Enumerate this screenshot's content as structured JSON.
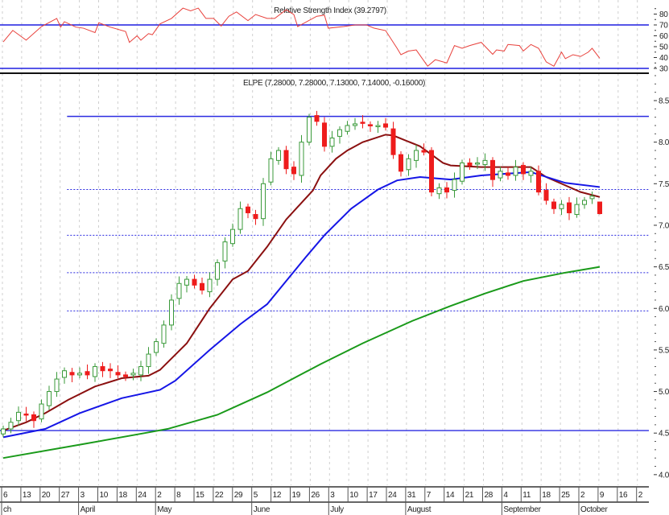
{
  "chart_data": [
    {
      "type": "line",
      "panel": "rsi",
      "title": "Relative Strength Index (39.2797)",
      "ylim": [
        30,
        85
      ],
      "yticks": [
        80,
        70,
        60,
        50,
        40,
        30
      ],
      "reference_lines": [
        70,
        30
      ],
      "colors": {
        "line": "#e8413c",
        "reference": "#1f1fe0"
      },
      "series": [
        {
          "name": "RSI",
          "points": [
            [
              0,
              54.4
            ],
            [
              2.5,
              65
            ],
            [
              6,
              56
            ],
            [
              10,
              68.5
            ],
            [
              14,
              76
            ],
            [
              15,
              68
            ],
            [
              16,
              73
            ],
            [
              19,
              68
            ],
            [
              21,
              67
            ],
            [
              24,
              63
            ],
            [
              25,
              72
            ],
            [
              28,
              68
            ],
            [
              32,
              64
            ],
            [
              33,
              54
            ],
            [
              35,
              60
            ],
            [
              36,
              56
            ],
            [
              38,
              62
            ],
            [
              39,
              61
            ],
            [
              41,
              71
            ],
            [
              44,
              76
            ],
            [
              47,
              85.5
            ],
            [
              49,
              83
            ],
            [
              51,
              85.5
            ],
            [
              53,
              76
            ],
            [
              55,
              76
            ],
            [
              57,
              69
            ],
            [
              59,
              78
            ],
            [
              61,
              82
            ],
            [
              64,
              74
            ],
            [
              66,
              79.6
            ],
            [
              69,
              76
            ],
            [
              71,
              76
            ],
            [
              74,
              84
            ],
            [
              76,
              79.6
            ],
            [
              77,
              68.5
            ],
            [
              82,
              78
            ],
            [
              84,
              79
            ],
            [
              85,
              67
            ],
            [
              89,
              68.5
            ],
            [
              92,
              70
            ],
            [
              95,
              70
            ],
            [
              97,
              67
            ],
            [
              100,
              64.8
            ],
            [
              103,
              48.5
            ],
            [
              104,
              42.6
            ],
            [
              106,
              46
            ],
            [
              108,
              47
            ],
            [
              111,
              32
            ],
            [
              113,
              38
            ],
            [
              116,
              35
            ],
            [
              118,
              51
            ],
            [
              120,
              48.5
            ],
            [
              122,
              51
            ],
            [
              125,
              54
            ],
            [
              128,
              43
            ],
            [
              129,
              47
            ],
            [
              131,
              46
            ],
            [
              132,
              52
            ],
            [
              135,
              51
            ],
            [
              136,
              46
            ],
            [
              138,
              52
            ],
            [
              140,
              48.5
            ],
            [
              142,
              36
            ],
            [
              144,
              32
            ],
            [
              146,
              45
            ],
            [
              147,
              39
            ],
            [
              149,
              42.6
            ],
            [
              151,
              41
            ],
            [
              153,
              45
            ],
            [
              154,
              48.5
            ],
            [
              156,
              39.3
            ]
          ]
        }
      ]
    },
    {
      "type": "candlestick",
      "panel": "price",
      "title": "ELPE (7.28000, 7.28000, 7.13000, 7.14000, -0.16000)",
      "ylim": [
        3.9,
        8.65
      ],
      "yticks": [
        "8.5",
        "8.0",
        "7.5",
        "7.0",
        "6.5",
        "6.0",
        "5.5",
        "5.0",
        "4.5",
        "4.0"
      ],
      "last_bar": {
        "open": 7.28,
        "high": 7.28,
        "low": 7.13,
        "close": 7.14,
        "change": -0.16
      },
      "colors": {
        "up": "#3a9a3a",
        "down": "#ee1c1c",
        "ma_short": "#8b1010",
        "ma_mid": "#1515e6",
        "ma_long": "#1a9a1a",
        "levels": "#2a2ae0"
      },
      "candle_day_step": 2,
      "closes": [
        4.55,
        4.63,
        4.75,
        4.72,
        4.65,
        4.85,
        5.0,
        5.15,
        5.25,
        5.2,
        5.22,
        5.2,
        5.3,
        5.25,
        5.25,
        5.2,
        5.18,
        5.22,
        5.3,
        5.45,
        5.6,
        5.8,
        6.1,
        6.3,
        6.35,
        6.28,
        6.22,
        6.35,
        6.55,
        6.8,
        6.95,
        7.2,
        7.15,
        7.08,
        7.5,
        7.8,
        7.9,
        7.68,
        7.62,
        8.0,
        8.3,
        8.25,
        7.95,
        8.05,
        8.15,
        8.2,
        8.22,
        8.23,
        8.2,
        8.2,
        8.18,
        7.85,
        7.65,
        7.8,
        7.9,
        7.88,
        7.4,
        7.45,
        7.4,
        7.55,
        7.75,
        7.72,
        7.75,
        7.78,
        7.55,
        7.65,
        7.6,
        7.7,
        7.62,
        7.65,
        7.4,
        7.3,
        7.2,
        7.25,
        7.15,
        7.25,
        7.3,
        7.35,
        7.14
      ],
      "moving_averages": [
        {
          "name": "MA short",
          "color_key": "ma_short",
          "points": [
            [
              0,
              4.53
            ],
            [
              6,
              4.63
            ],
            [
              11,
              4.74
            ],
            [
              17,
              4.9
            ],
            [
              24,
              5.06
            ],
            [
              31,
              5.16
            ],
            [
              38,
              5.19
            ],
            [
              41,
              5.26
            ],
            [
              48,
              5.58
            ],
            [
              54,
              6.0
            ],
            [
              60,
              6.35
            ],
            [
              64,
              6.45
            ],
            [
              69,
              6.74
            ],
            [
              74,
              7.07
            ],
            [
              77,
              7.22
            ],
            [
              81,
              7.42
            ],
            [
              83,
              7.6
            ],
            [
              87,
              7.8
            ],
            [
              90,
              7.9
            ],
            [
              94,
              8.0
            ],
            [
              100,
              8.09
            ],
            [
              102,
              8.08
            ],
            [
              109,
              7.95
            ],
            [
              115,
              7.75
            ],
            [
              117,
              7.72
            ],
            [
              125,
              7.7
            ],
            [
              138,
              7.7
            ],
            [
              142,
              7.58
            ],
            [
              147,
              7.48
            ],
            [
              151,
              7.4
            ],
            [
              156,
              7.34
            ]
          ]
        },
        {
          "name": "MA mid",
          "color_key": "ma_mid",
          "points": [
            [
              0,
              4.45
            ],
            [
              11,
              4.55
            ],
            [
              20,
              4.74
            ],
            [
              31,
              4.92
            ],
            [
              41,
              5.02
            ],
            [
              45,
              5.13
            ],
            [
              54,
              5.5
            ],
            [
              62,
              5.81
            ],
            [
              69,
              6.05
            ],
            [
              79,
              6.61
            ],
            [
              84,
              6.88
            ],
            [
              91,
              7.2
            ],
            [
              98,
              7.43
            ],
            [
              103,
              7.54
            ],
            [
              109,
              7.58
            ],
            [
              117,
              7.55
            ],
            [
              125,
              7.6
            ],
            [
              138,
              7.64
            ],
            [
              147,
              7.51
            ],
            [
              156,
              7.46
            ]
          ]
        },
        {
          "name": "MA long",
          "color_key": "ma_long",
          "points": [
            [
              0,
              4.2
            ],
            [
              20,
              4.36
            ],
            [
              37,
              4.5
            ],
            [
              43,
              4.55
            ],
            [
              56,
              4.72
            ],
            [
              69,
              4.99
            ],
            [
              83,
              5.33
            ],
            [
              94,
              5.58
            ],
            [
              107,
              5.85
            ],
            [
              117,
              6.03
            ],
            [
              126,
              6.18
            ],
            [
              136,
              6.33
            ],
            [
              147,
              6.43
            ],
            [
              156,
              6.5
            ]
          ]
        }
      ],
      "levels": [
        {
          "value": 8.31,
          "style": "solid",
          "from_day": 16.7
        },
        {
          "value": 7.43,
          "style": "dotted",
          "from_day": 16.7
        },
        {
          "value": 6.88,
          "style": "dotted",
          "from_day": 16.7
        },
        {
          "value": 6.43,
          "style": "dotted",
          "from_day": 16.7
        },
        {
          "value": 5.97,
          "style": "dotted",
          "from_day": 16.7
        },
        {
          "value": 4.53,
          "style": "solid",
          "from_day": -1
        }
      ],
      "xaxis": {
        "week_labels": [
          "6",
          "13",
          "20",
          "27",
          "3",
          "10",
          "18",
          "24",
          "2",
          "8",
          "15",
          "22",
          "29",
          "5",
          "12",
          "19",
          "26",
          "3",
          "10",
          "17",
          "24",
          "31",
          "7",
          "14",
          "21",
          "28",
          "4",
          "11",
          "18",
          "25",
          "2",
          "9",
          "16",
          "2"
        ],
        "months": [
          {
            "label": "ch",
            "week": 0
          },
          {
            "label": "April",
            "week": 4
          },
          {
            "label": "May",
            "week": 8
          },
          {
            "label": "June",
            "week": 13
          },
          {
            "label": "July",
            "week": 17
          },
          {
            "label": "August",
            "week": 21
          },
          {
            "label": "September",
            "week": 26
          },
          {
            "label": "October",
            "week": 30
          }
        ]
      }
    }
  ]
}
